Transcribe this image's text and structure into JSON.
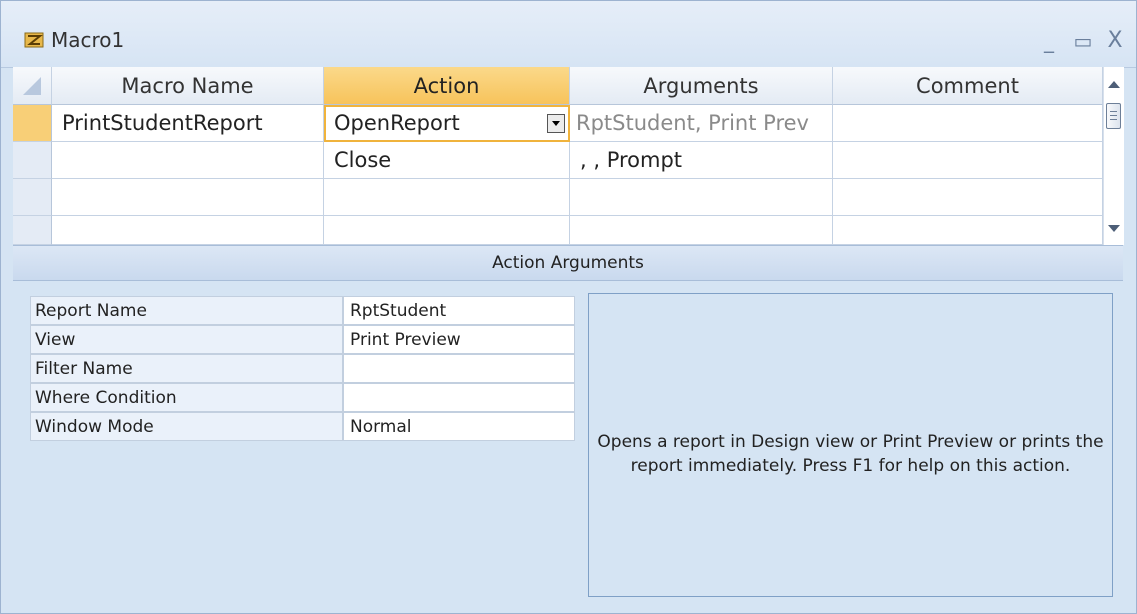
{
  "window": {
    "title": "Macro1",
    "minimize_label": "_",
    "maximize_label": "▭",
    "close_label": "X"
  },
  "grid": {
    "columns": [
      "Macro Name",
      "Action",
      "Arguments",
      "Comment"
    ],
    "rows": [
      {
        "macro_name": "PrintStudentReport",
        "action": "OpenReport",
        "arguments": "RptStudent, Print Prev",
        "comment": ""
      },
      {
        "macro_name": "",
        "action": "Close",
        "arguments": ", , Prompt",
        "comment": ""
      },
      {
        "macro_name": "",
        "action": "",
        "arguments": "",
        "comment": ""
      },
      {
        "macro_name": "",
        "action": "",
        "arguments": "",
        "comment": ""
      }
    ]
  },
  "action_arguments": {
    "section_title": "Action Arguments",
    "fields": [
      {
        "label": "Report Name",
        "value": "RptStudent"
      },
      {
        "label": "View",
        "value": "Print Preview"
      },
      {
        "label": "Filter Name",
        "value": ""
      },
      {
        "label": "Where Condition",
        "value": ""
      },
      {
        "label": "Window Mode",
        "value": "Normal"
      }
    ],
    "help_text": "Opens a report in Design view or Print Preview or prints the report immediately. Press F1 for help on this action."
  },
  "colors": {
    "accent": "#f7c35b",
    "background": "#d5e4f3"
  },
  "icons": {
    "title": "macro-icon",
    "dropdown": "dropdown-arrow-icon"
  }
}
